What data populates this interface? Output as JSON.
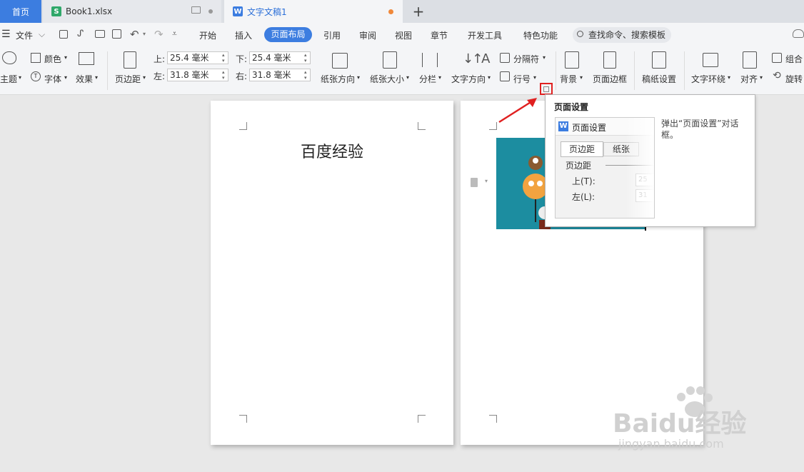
{
  "tabs": {
    "home": "首页",
    "book": "Book1.xlsx",
    "doc": "文字文稿1",
    "book_icon_letter": "S",
    "doc_icon_letter": "W"
  },
  "menu": {
    "file": "文件",
    "items": [
      "开始",
      "插入",
      "页面布局",
      "引用",
      "审阅",
      "视图",
      "章节",
      "开发工具",
      "特色功能"
    ],
    "search_placeholder": "查找命令、搜索模板"
  },
  "ribbon": {
    "theme": "主题",
    "color": "颜色",
    "font": "字体",
    "effect": "效果",
    "margins": "页边距",
    "top_label": "上:",
    "top_value": "25.4 毫米",
    "bottom_label": "下:",
    "bottom_value": "25.4 毫米",
    "left_label": "左:",
    "left_value": "31.8 毫米",
    "right_label": "右:",
    "right_value": "31.8 毫米",
    "orientation": "纸张方向",
    "size": "纸张大小",
    "columns": "分栏",
    "text_direction": "文字方向",
    "breaks": "分隔符",
    "line_numbers": "行号",
    "background": "背景",
    "page_border": "页面边框",
    "grid_paper": "稿纸设置",
    "wrap_text": "文字环绕",
    "align": "对齐",
    "group": "组合",
    "rotate": "旋转"
  },
  "document": {
    "page1_title": "百度经验"
  },
  "tooltip": {
    "title": "页面设置",
    "preview_title": "页面设置",
    "preview_tab1": "页边距",
    "preview_tab2": "纸张",
    "preview_section": "页边距",
    "preview_top": "上(T):",
    "preview_left": "左(L):",
    "preview_top_value": "25",
    "preview_left_value": "31",
    "description": "弹出“页面设置”对话框。"
  },
  "watermark": {
    "brand": "Baidu经验",
    "url": "jingyan.baidu.com"
  },
  "colors": {
    "accent": "#3c7de0",
    "annotation": "#e02020",
    "image_bg": "#1c8da0"
  }
}
